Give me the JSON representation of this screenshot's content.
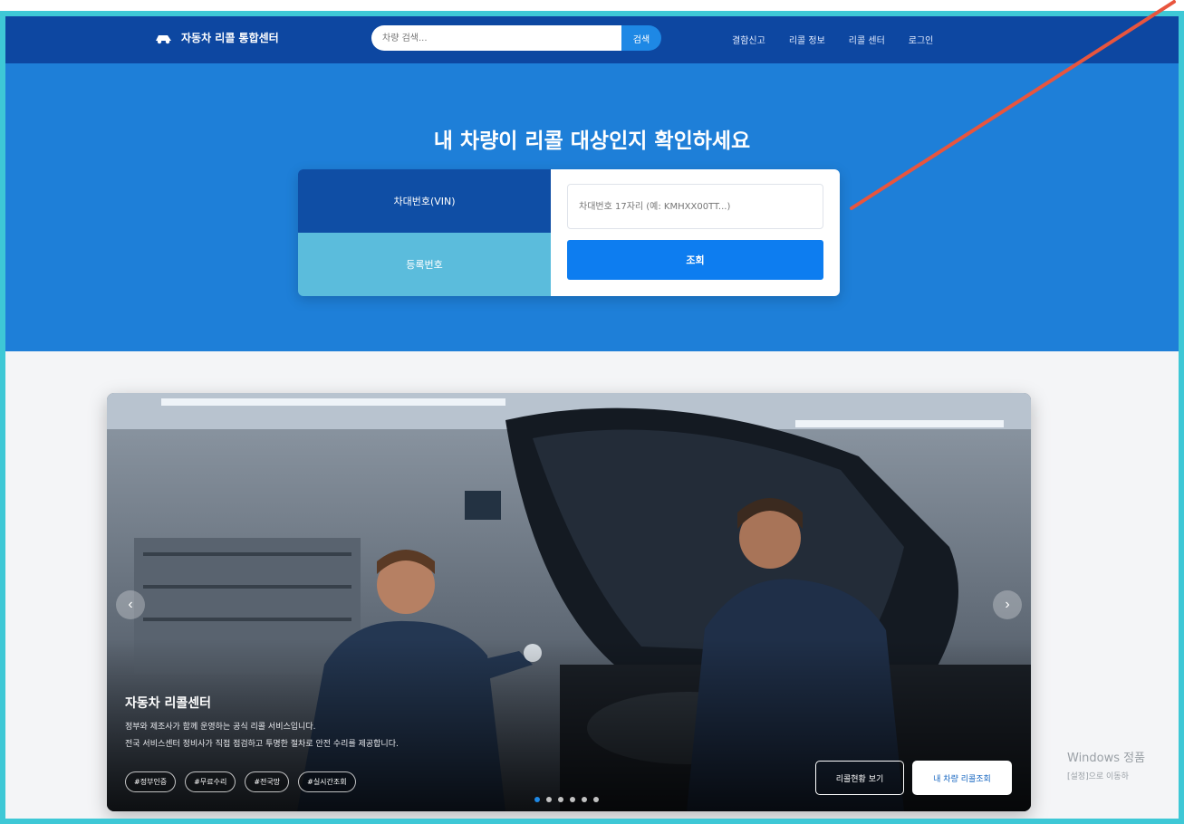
{
  "header": {
    "logo_text": "자동차 리콜 통합센터",
    "logo_icon": "car-icon",
    "search_placeholder": "차량 검색...",
    "search_button": "검색",
    "nav_links": [
      "결함신고",
      "리콜 정보",
      "리콜 센터",
      "로그인"
    ]
  },
  "hero": {
    "title": "내 차량이 리콜 대상인지 확인하세요",
    "tabs": [
      "차대번호(VIN)",
      "등록번호"
    ],
    "active_tab": "차대번호(VIN)",
    "vin_placeholder": "차대번호 17자리 (예: KMHXX00TT...)",
    "lookup_button": "조회"
  },
  "banner": {
    "title": "자동차 리콜센터",
    "description_line1": "정부와 제조사가 함께 운영하는 공식 리콜 서비스입니다.",
    "description_line2": "전국 서비스센터 정비사가 직접 점검하고 투명한 절차로 안전 수리를 제공합니다.",
    "tags": [
      "#정부인증",
      "#무료수리",
      "#전국망",
      "#실시간조회"
    ],
    "btn_status": "리콜현황 보기",
    "btn_my_recall": "내 차량 리콜조회",
    "prev_icon": "‹",
    "next_icon": "›",
    "slide_count": 6,
    "active_slide": 1
  },
  "watermark": {
    "line1": "Windows 정품",
    "line2": "[설정]으로 이동하"
  },
  "colors": {
    "nav_bg": "#0d47a1",
    "hero_bg": "#1e7fd8",
    "accent": "#0d7df0",
    "tab_active": "#0f4ea5",
    "tab_inactive": "#5bbcdc",
    "frame_border": "#3ec8d6",
    "annotation_arrow": "#e8553e"
  }
}
